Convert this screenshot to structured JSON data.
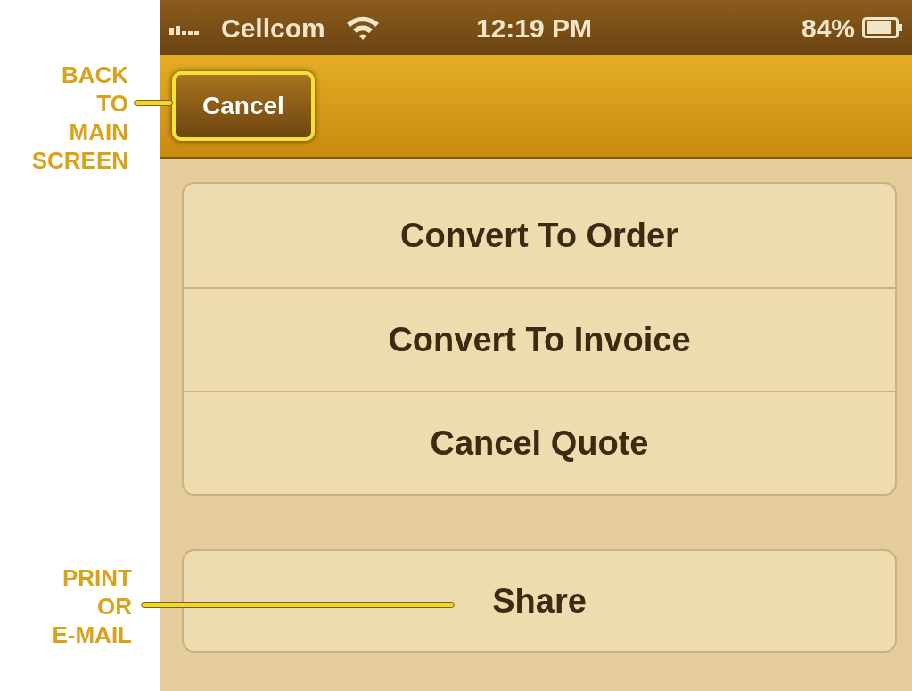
{
  "status_bar": {
    "carrier": "Cellcom",
    "time": "12:19 PM",
    "battery": "84%"
  },
  "nav_bar": {
    "cancel_button": {
      "label": "Cancel",
      "highlighted": true
    }
  },
  "actions": [
    {
      "label": "Convert To Order"
    },
    {
      "label": "Convert To Invoice"
    },
    {
      "label": "Cancel Quote"
    }
  ],
  "share_button": {
    "label": "Share"
  },
  "annotations": [
    {
      "lines": [
        "BACK",
        "TO",
        "MAIN",
        "SCREEN"
      ]
    },
    {
      "lines": [
        "PRINT",
        "OR",
        "E-MAIL"
      ]
    }
  ]
}
